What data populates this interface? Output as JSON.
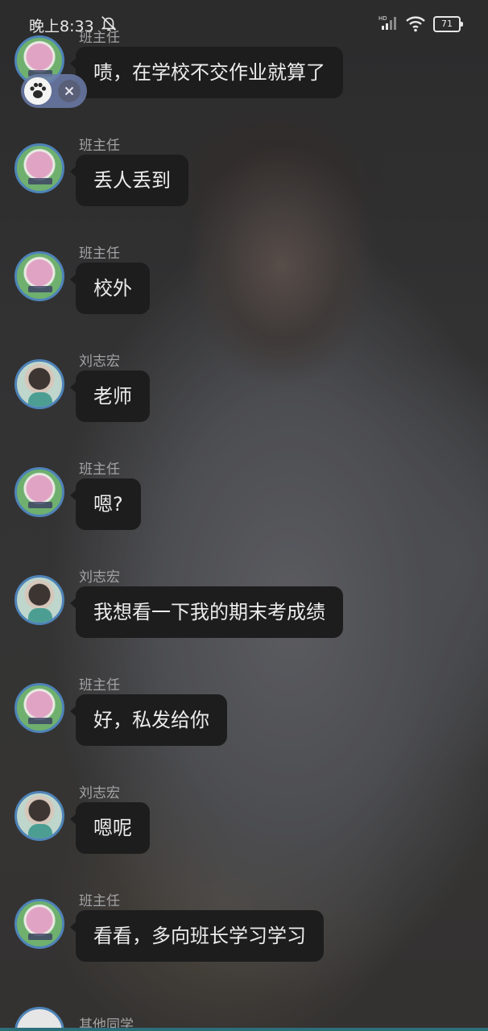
{
  "status_bar": {
    "time": "晚上8:33",
    "battery": "71",
    "icons": [
      "bell-off-icon",
      "hd-signal-icon",
      "wifi-icon",
      "battery-icon"
    ]
  },
  "messages": [
    {
      "sender": "班主任",
      "text": "啧，在学校不交作业就算了",
      "avatar": "teacher"
    },
    {
      "sender": "班主任",
      "text": "丢人丢到",
      "avatar": "teacher"
    },
    {
      "sender": "班主任",
      "text": "校外",
      "avatar": "teacher"
    },
    {
      "sender": "刘志宏",
      "text": "老师",
      "avatar": "student"
    },
    {
      "sender": "班主任",
      "text": "嗯?",
      "avatar": "teacher"
    },
    {
      "sender": "刘志宏",
      "text": "我想看一下我的期末考成绩",
      "avatar": "student"
    },
    {
      "sender": "班主任",
      "text": "好，私发给你",
      "avatar": "teacher"
    },
    {
      "sender": "刘志宏",
      "text": "嗯呢",
      "avatar": "student"
    },
    {
      "sender": "班主任",
      "text": "看看，多向班长学习学习",
      "avatar": "teacher"
    },
    {
      "sender": "其他同学",
      "text": "",
      "avatar": "other"
    }
  ],
  "colors": {
    "bubble": "#1d1d1e",
    "avatar_border": "#4e83b8",
    "sender_text": "#a3a3a6"
  }
}
